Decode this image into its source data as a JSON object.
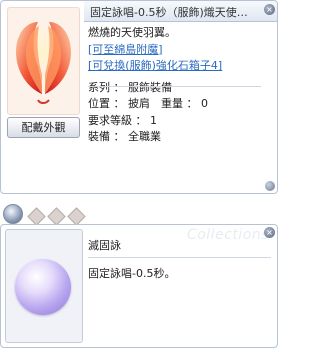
{
  "item_window": {
    "title": "固定詠唱-0.5秒（服飾)熾天使…",
    "appearance_button": "配戴外觀",
    "description": {
      "line1": "燃燒的天使羽翼。",
      "link1": "[可至綿島附魔]",
      "link2": "[可兌換(服飾)強化石箱子4]",
      "category": "系列 ： 服飾裝備",
      "position_weight": "位置 ： 披肩　重量 ： 0",
      "required_level": "要求等級 ： 1",
      "equip": "裝備 ： 全職業"
    },
    "close_icon": "×"
  },
  "slots": {
    "filled": 1,
    "empty": 3
  },
  "info_window": {
    "title": "滅固詠",
    "effect": "固定詠唱-0.5秒。",
    "watermark": "Collections",
    "close_icon": "×"
  },
  "colors": {
    "link": "#2b6bc0",
    "border": "#b7c3d4",
    "wing_red": "#e8322e",
    "orb_purple": "#b9a7f0"
  }
}
